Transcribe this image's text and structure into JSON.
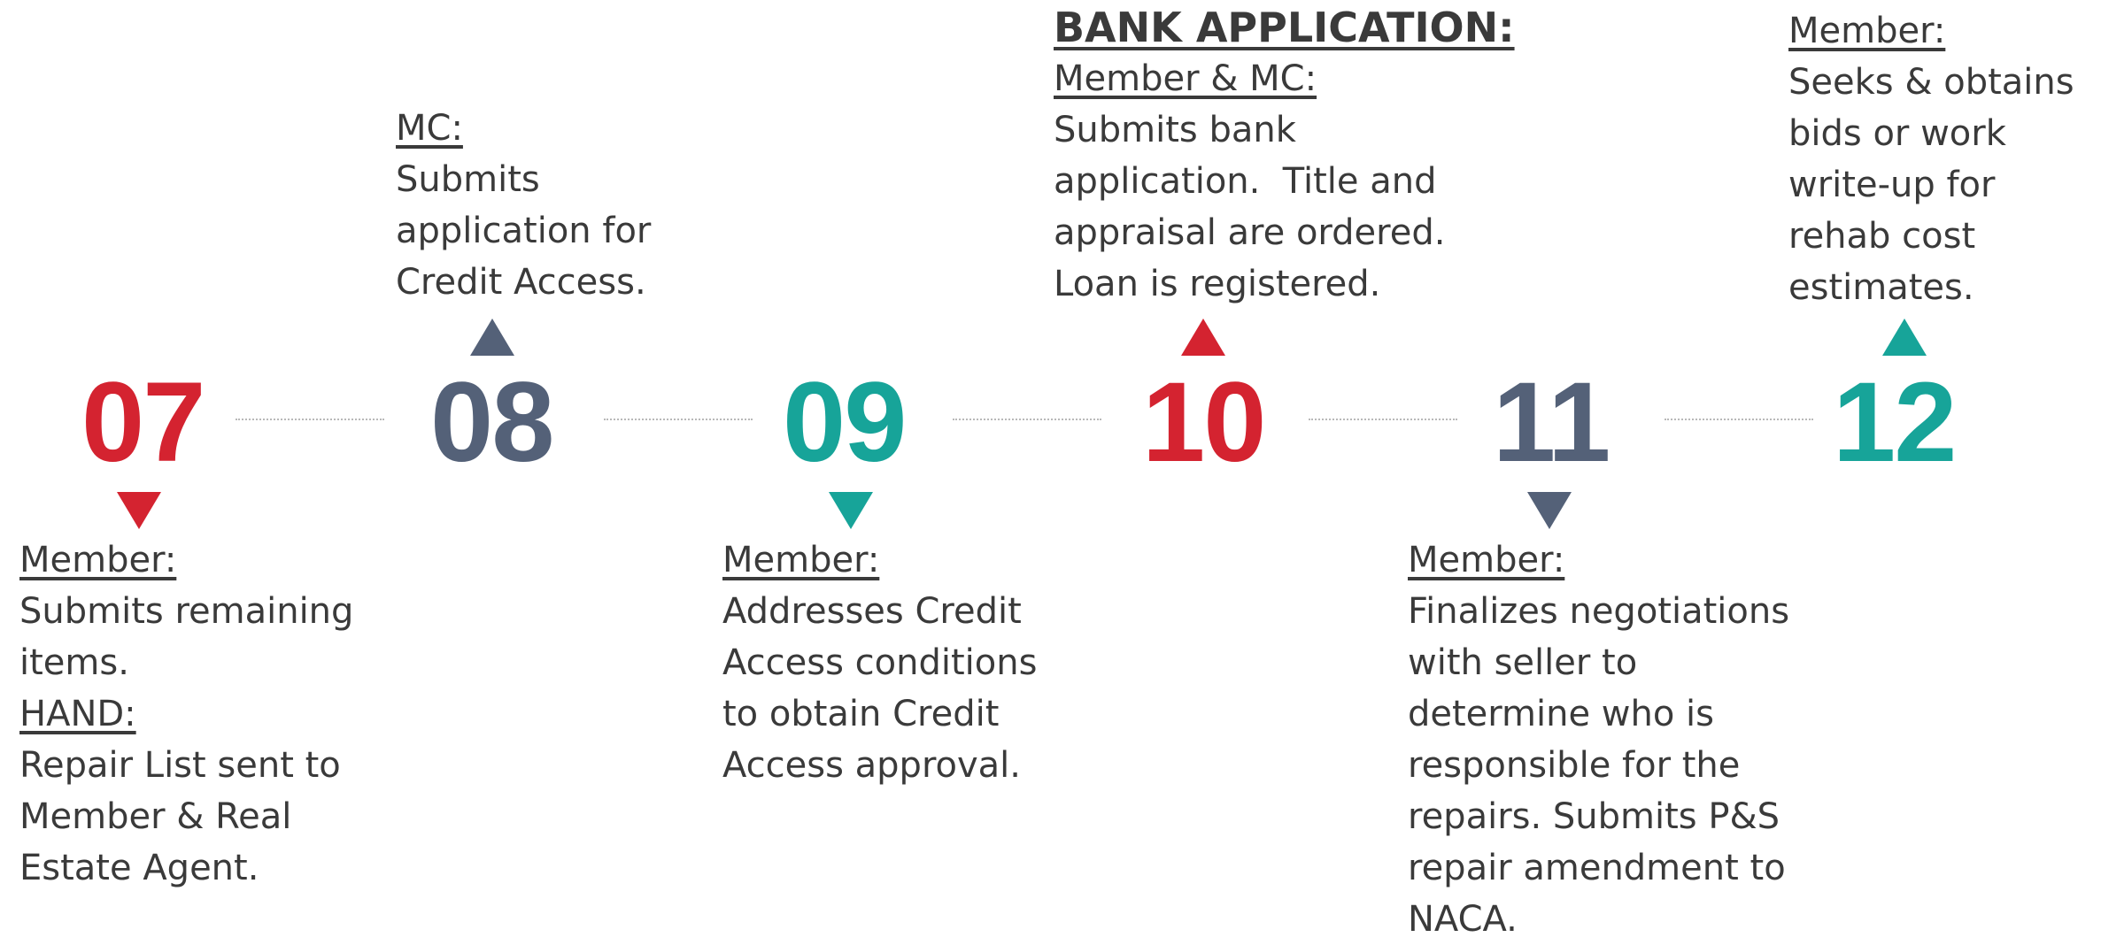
{
  "steps": [
    {
      "number": "07",
      "color": "red",
      "blocks": [
        {
          "label": "Member:",
          "lines": [
            "Submits remaining",
            "items."
          ]
        },
        {
          "label": "HAND:",
          "lines": [
            "Repair List sent to",
            "Member & Real",
            "Estate Agent."
          ]
        }
      ]
    },
    {
      "number": "08",
      "color": "slate",
      "blocks": [
        {
          "label": "MC:",
          "lines": [
            "Submits",
            "application for",
            "Credit Access."
          ]
        }
      ]
    },
    {
      "number": "09",
      "color": "teal",
      "blocks": [
        {
          "label": "Member:",
          "lines": [
            "Addresses Credit",
            "Access conditions",
            "to obtain Credit",
            "Access approval."
          ]
        }
      ]
    },
    {
      "number": "10",
      "color": "red",
      "heading": "BANK APPLICATION:",
      "blocks": [
        {
          "label": "Member & MC:",
          "lines": [
            "Submits bank",
            "application.  Title and",
            "appraisal are ordered.",
            "Loan is registered."
          ]
        }
      ]
    },
    {
      "number": "11",
      "color": "slate",
      "blocks": [
        {
          "label": "Member:",
          "lines": [
            "Finalizes negotiations",
            "with seller to",
            "determine who is",
            "responsible for the",
            "repairs. Submits P&S",
            "repair amendment to",
            "NACA."
          ]
        }
      ]
    },
    {
      "number": "12",
      "color": "teal",
      "blocks": [
        {
          "label": "Member:",
          "lines": [
            "Seeks & obtains",
            "bids or work",
            "write-up for",
            "rehab cost",
            "estimates."
          ]
        }
      ]
    }
  ],
  "colors": {
    "red": "#d42330",
    "slate": "#546178",
    "teal": "#17a499"
  }
}
